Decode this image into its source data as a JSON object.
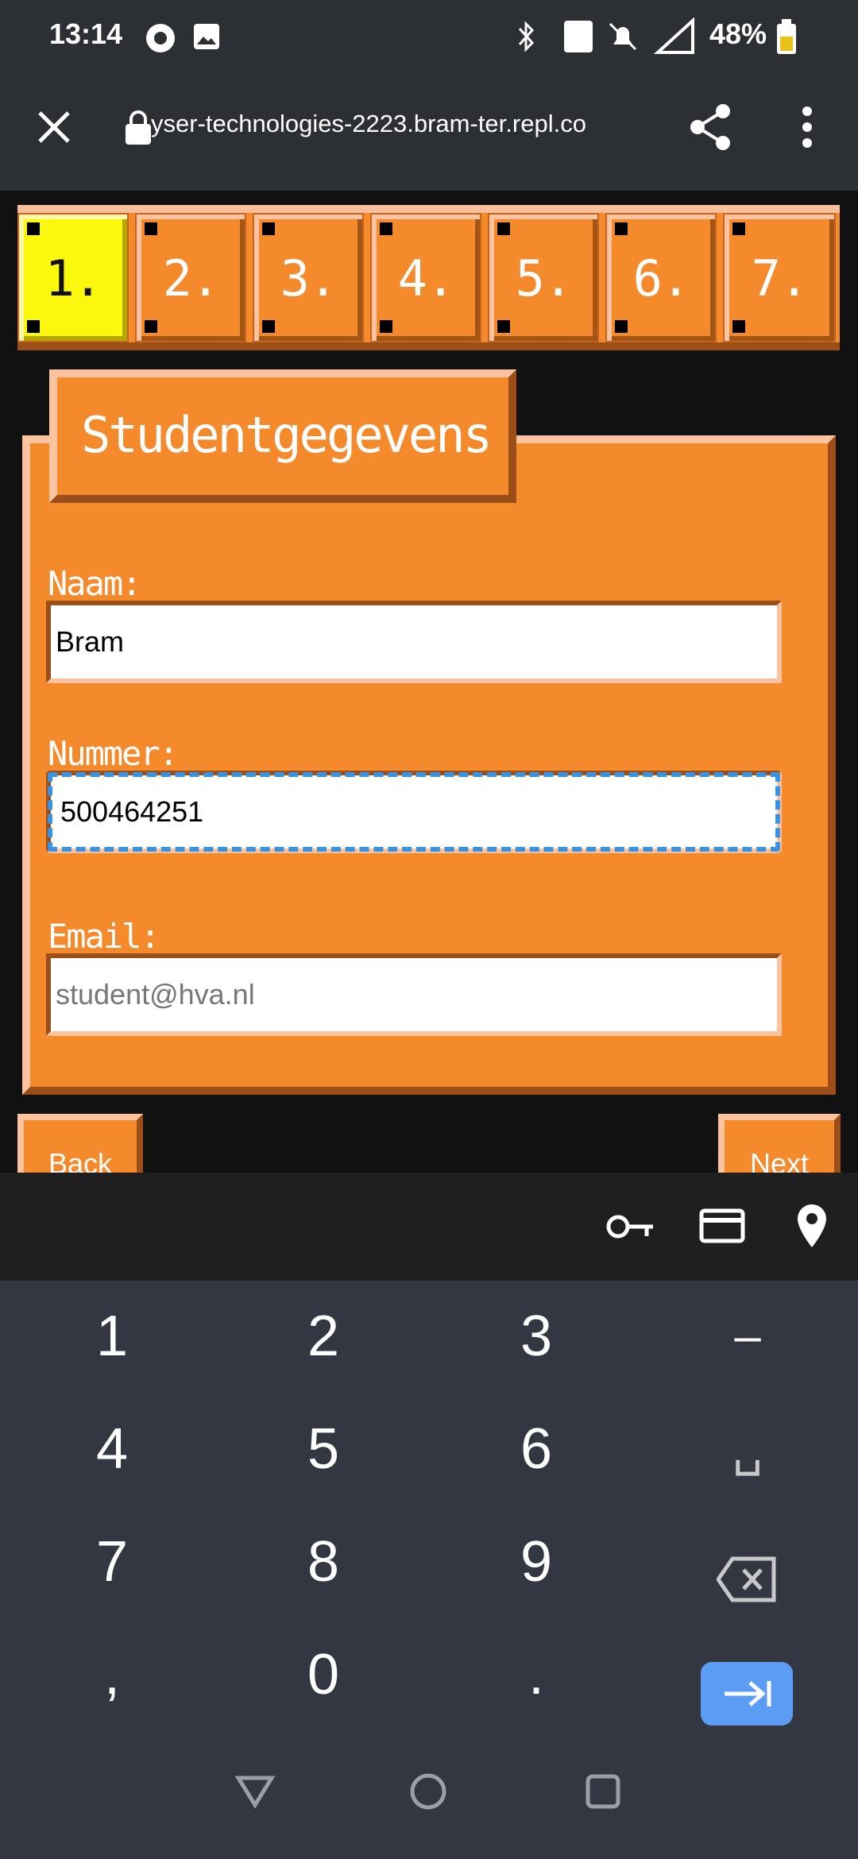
{
  "status_bar": {
    "time": "13:14",
    "battery": "48%"
  },
  "browser": {
    "url": "уser-technologies-2223.bram-ter.repl.co"
  },
  "steps": {
    "items": [
      {
        "label": "1.",
        "active": true
      },
      {
        "label": "2.",
        "active": false
      },
      {
        "label": "3.",
        "active": false
      },
      {
        "label": "4.",
        "active": false
      },
      {
        "label": "5.",
        "active": false
      },
      {
        "label": "6.",
        "active": false
      },
      {
        "label": "7.",
        "active": false
      }
    ]
  },
  "form": {
    "title": "Studentgegevens",
    "name_label": "Naam:",
    "name_value": "Bram",
    "number_label": "Nummer:",
    "number_value": "500464251",
    "email_label": "Email:",
    "email_placeholder": "student@hva.nl"
  },
  "nav": {
    "back": "Back",
    "next": "Next"
  },
  "keyboard": {
    "keys": [
      "1",
      "2",
      "3",
      "–",
      "4",
      "5",
      "6",
      "␣",
      "7",
      "8",
      "9",
      "",
      ",",
      "0",
      ".",
      ""
    ]
  },
  "colors": {
    "accent": "#f58a2d",
    "active_step": "#fbf70d",
    "focus": "#3a93e0"
  }
}
